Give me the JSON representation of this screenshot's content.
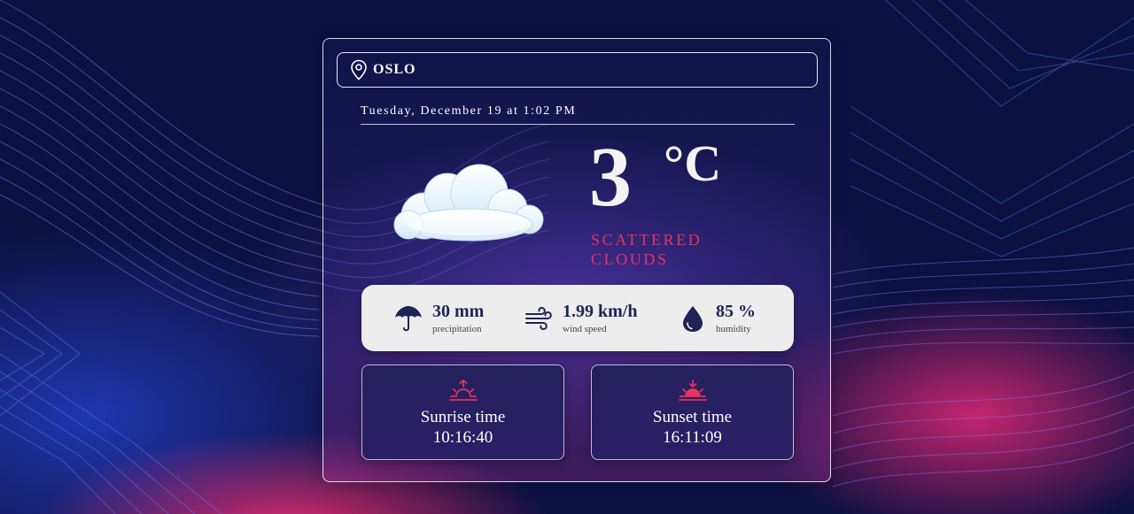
{
  "location": {
    "city": "OSLO"
  },
  "datetime": "Tuesday, December 19 at 1:02 PM",
  "weather": {
    "temperature": "3",
    "unit": "°C",
    "condition": "Scattered Clouds",
    "icon": "cloud-icon"
  },
  "stats": [
    {
      "value": "30 mm",
      "label": "precipitation",
      "icon": "umbrella-icon"
    },
    {
      "value": "1.99 km/h",
      "label": "wind speed",
      "icon": "wind-icon"
    },
    {
      "value": "85 %",
      "label": "humidity",
      "icon": "droplet-icon"
    }
  ],
  "sunrise": {
    "title": "Sunrise time",
    "time": "10:16:40",
    "icon": "sunrise-icon"
  },
  "sunset": {
    "title": "Sunset time",
    "time": "16:11:09",
    "icon": "sunset-icon"
  },
  "colors": {
    "accent": "#e8325f",
    "stats_text": "#1f2257",
    "stats_bg": "#ededed",
    "background": "#0c1140"
  }
}
